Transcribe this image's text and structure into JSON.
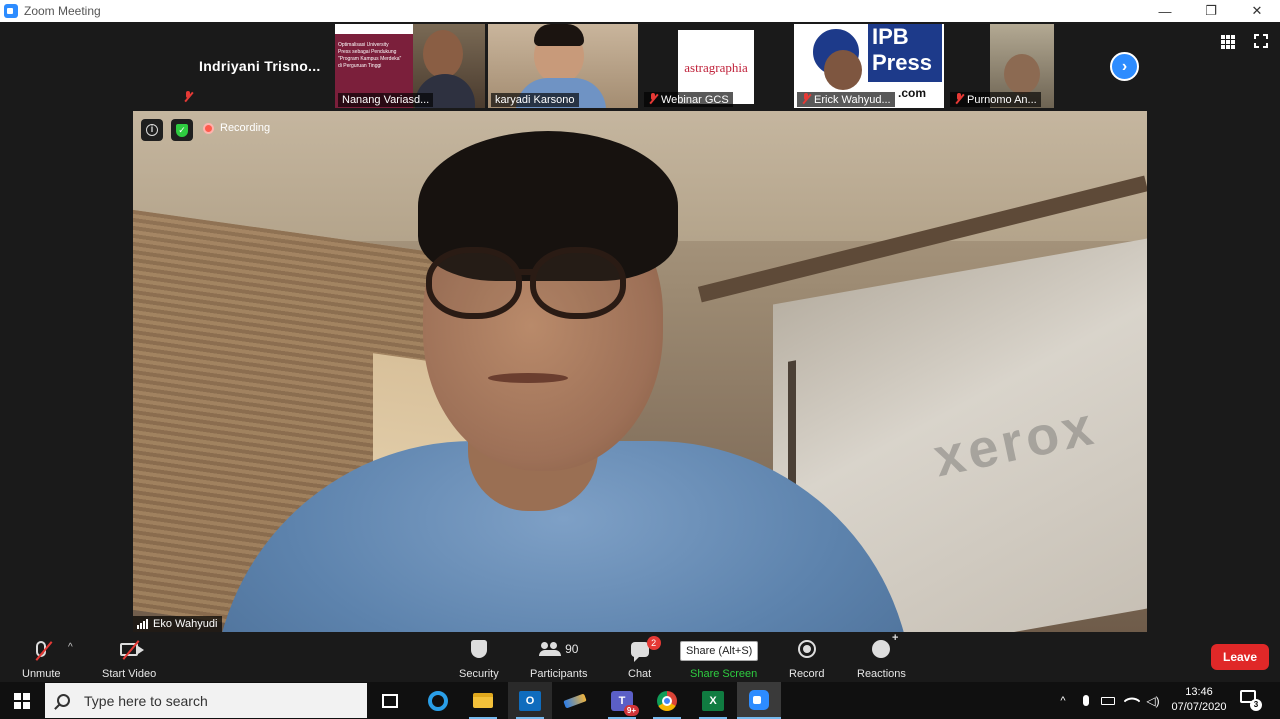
{
  "window": {
    "title": "Zoom Meeting",
    "minimize_label": "—",
    "restore_label": "❐",
    "close_label": "✕"
  },
  "thumbnails": [
    {
      "name": "Indriyani  Trisno...",
      "muted": true,
      "has_video": false
    },
    {
      "name": "Nanang Variasd...",
      "muted": false,
      "has_video": true,
      "slide_text": [
        "Optimalisasi University",
        "Press sebagai Pendukung",
        "\"Program Kampus Merdeka\"",
        "di Perguruan Tinggi"
      ]
    },
    {
      "name": "karyadi Karsono",
      "muted": false,
      "has_video": true
    },
    {
      "name": "Webinar GCS",
      "muted": true,
      "has_video": true,
      "logo_text": "astragraphia"
    },
    {
      "name": "Erick Wahyud...",
      "muted": true,
      "has_video": true,
      "logo_text": "IPB Press",
      "logo_sub": ".com"
    },
    {
      "name": "Purnomo An...",
      "muted": true,
      "has_video": true
    }
  ],
  "main_video": {
    "recording_label": "Recording",
    "speaker_name": "Eko Wahyudi",
    "background_text": "xerox"
  },
  "toolbar": {
    "unmute_label": "Unmute",
    "start_video_label": "Start Video",
    "security_label": "Security",
    "participants_label": "Participants",
    "participants_count": "90",
    "chat_label": "Chat",
    "chat_badge": "2",
    "share_label": "Share Screen",
    "share_tooltip": "Share (Alt+S)",
    "record_label": "Record",
    "reactions_label": "Reactions",
    "leave_label": "Leave"
  },
  "taskbar": {
    "search_placeholder": "Type here to search",
    "outlook_letter": "O",
    "teams_letter": "T",
    "teams_badge": "9+",
    "excel_letter": "X",
    "time": "13:46",
    "date": "07/07/2020",
    "notification_count": "3"
  },
  "colors": {
    "accent_blue": "#2d8cff",
    "leave_red": "#e02828",
    "share_green": "#2ecc40",
    "mute_red": "#e53935"
  }
}
